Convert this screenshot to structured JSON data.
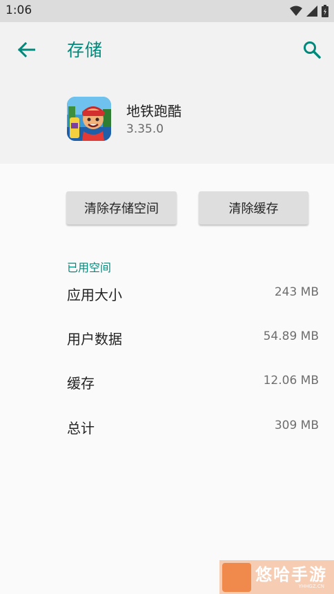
{
  "status_bar": {
    "time": "1:06"
  },
  "header": {
    "title": "存储"
  },
  "app": {
    "name": "地铁跑酷",
    "version": "3.35.0"
  },
  "actions": {
    "clear_storage": "清除存储空间",
    "clear_cache": "清除缓存"
  },
  "section": {
    "title": "已用空间"
  },
  "storage_rows": [
    {
      "label": "应用大小",
      "value": "243 MB"
    },
    {
      "label": "用户数据",
      "value": "54.89 MB"
    },
    {
      "label": "缓存",
      "value": "12.06 MB"
    },
    {
      "label": "总计",
      "value": "309 MB"
    }
  ],
  "watermark": {
    "text": "悠哈手游",
    "subtext": "YHHGZ.CN"
  },
  "colors": {
    "accent": "#00897b",
    "status_bar": "#dcdcdc",
    "header_bg": "#f2f2f2",
    "button_bg": "#dedede"
  },
  "icons": [
    "wifi-icon",
    "cellular-icon",
    "battery-icon",
    "back-arrow-icon",
    "search-icon",
    "app-icon"
  ]
}
